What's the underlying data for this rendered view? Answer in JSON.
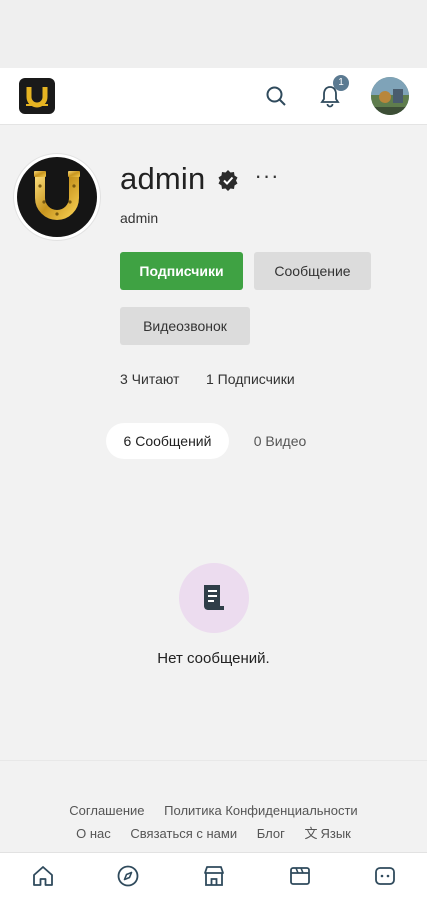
{
  "header": {
    "notification_count": "1"
  },
  "profile": {
    "display_name": "admin",
    "username": "admin",
    "more_label": "···"
  },
  "actions": {
    "subscribe_label": "Подписчики",
    "message_label": "Сообщение",
    "videocall_label": "Видеозвонок"
  },
  "stats": {
    "readers": "3 Читают",
    "subscribers": "1 Подписчики"
  },
  "tabs": [
    {
      "label": "6 Сообщений",
      "active": true
    },
    {
      "label": "0 Видео",
      "active": false
    }
  ],
  "empty_state": {
    "icon": "document-icon",
    "text": "Нет сообщений."
  },
  "footer": {
    "links": [
      "Соглашение",
      "Политика Конфиденциальности",
      "О нас",
      "Связаться с нами",
      "Блог"
    ],
    "language_label": "Язык"
  },
  "bottom_nav": [
    {
      "icon": "home-icon"
    },
    {
      "icon": "compass-icon"
    },
    {
      "icon": "store-icon"
    },
    {
      "icon": "clapperboard-icon"
    },
    {
      "icon": "chat-icon"
    }
  ],
  "colors": {
    "accent_green": "#3fa243",
    "badge": "#5b7a91",
    "empty_icon_bg": "#ecdcef",
    "nav_icon": "#2f4a5c"
  }
}
